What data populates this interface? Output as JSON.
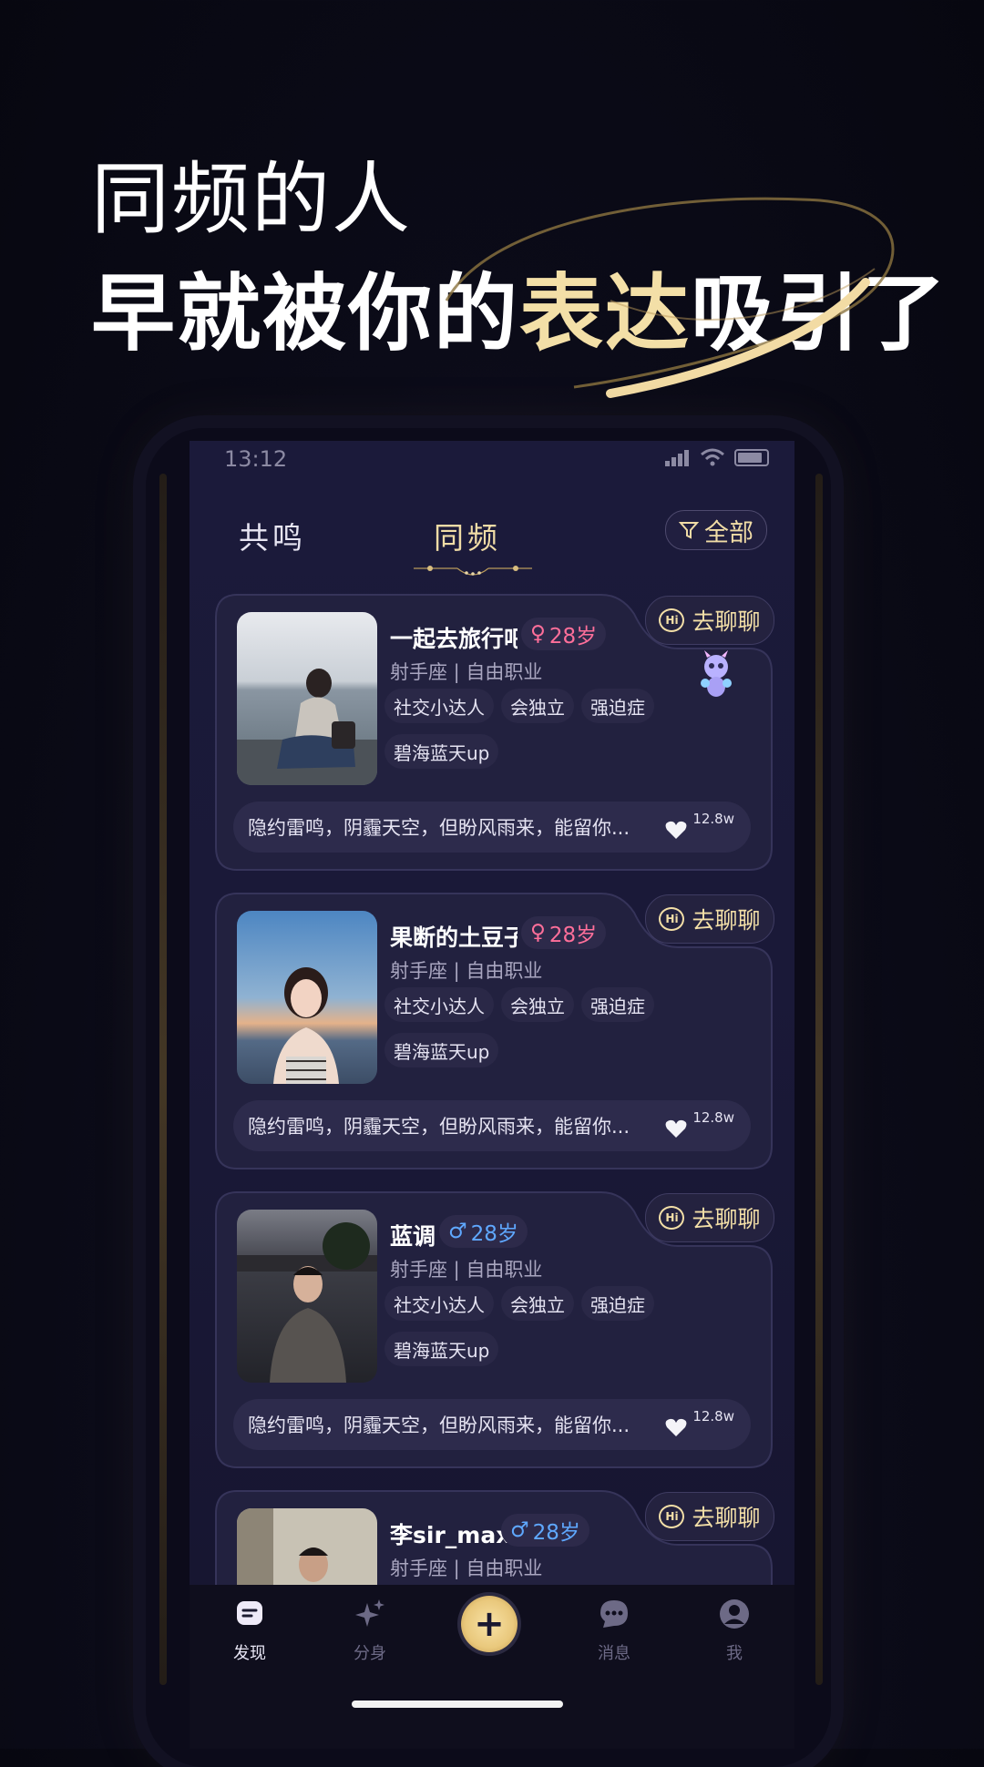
{
  "headline": {
    "line1": "同频的人",
    "line2_prefix": "早就被你的",
    "line2_highlight": "表达",
    "line2_suffix": "吸引了"
  },
  "status_bar": {
    "time": "13:12"
  },
  "tabs": [
    {
      "label": "共鸣"
    },
    {
      "label": "同频"
    }
  ],
  "filter": {
    "label": "全部"
  },
  "cards": [
    {
      "name": "一起去旅行吧",
      "gender": "female",
      "gender_icon": "♀",
      "age": "28岁",
      "subtitle": "射手座 | 自由职业",
      "tags": [
        "社交小达人",
        "会独立",
        "强迫症",
        "碧海蓝天up"
      ],
      "quote": "隐约雷鸣，阴霾天空，但盼风雨来，能留你...",
      "likes": "12.8w",
      "chat_label": "去聊聊"
    },
    {
      "name": "果断的土豆子",
      "gender": "female",
      "gender_icon": "♀",
      "age": "28岁",
      "subtitle": "射手座 | 自由职业",
      "tags": [
        "社交小达人",
        "会独立",
        "强迫症",
        "碧海蓝天up"
      ],
      "quote": "隐约雷鸣，阴霾天空，但盼风雨来，能留你...",
      "likes": "12.8w",
      "chat_label": "去聊聊"
    },
    {
      "name": "蓝调",
      "gender": "male",
      "gender_icon": "♂",
      "age": "28岁",
      "subtitle": "射手座 | 自由职业",
      "tags": [
        "社交小达人",
        "会独立",
        "强迫症",
        "碧海蓝天up"
      ],
      "quote": "隐约雷鸣，阴霾天空，但盼风雨来，能留你...",
      "likes": "12.8w",
      "chat_label": "去聊聊"
    },
    {
      "name": "李sir_max",
      "gender": "male",
      "gender_icon": "♂",
      "age": "28岁",
      "subtitle": "射手座 | 自由职业",
      "chat_label": "去聊聊"
    }
  ],
  "nav": [
    {
      "label": "发现"
    },
    {
      "label": "分身"
    },
    {
      "label": "消息"
    },
    {
      "label": "我"
    }
  ],
  "colors": {
    "accent_gold": "#f3dfa7",
    "female": "#ff6f9a",
    "male": "#5fa8ff",
    "background": "#0b0b18"
  }
}
